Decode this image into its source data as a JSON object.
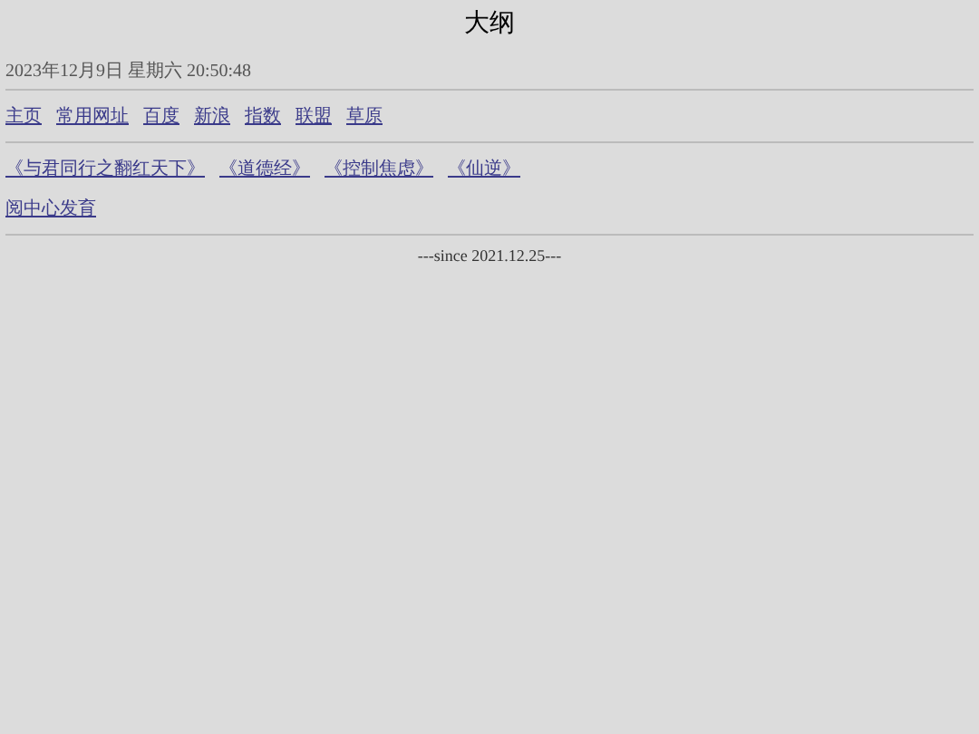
{
  "title": "大纲",
  "datetime": "2023年12月9日 星期六 20:50:48",
  "nav_links": [
    "主页",
    "常用网址",
    "百度",
    "新浪",
    "指数",
    "联盟",
    "草原"
  ],
  "book_links": [
    "《与君同行之翻红天下》",
    "《道德经》",
    "《控制焦虑》",
    "《仙逆》"
  ],
  "extra_link": "阅中心发育",
  "footer": "---since 2021.12.25---"
}
